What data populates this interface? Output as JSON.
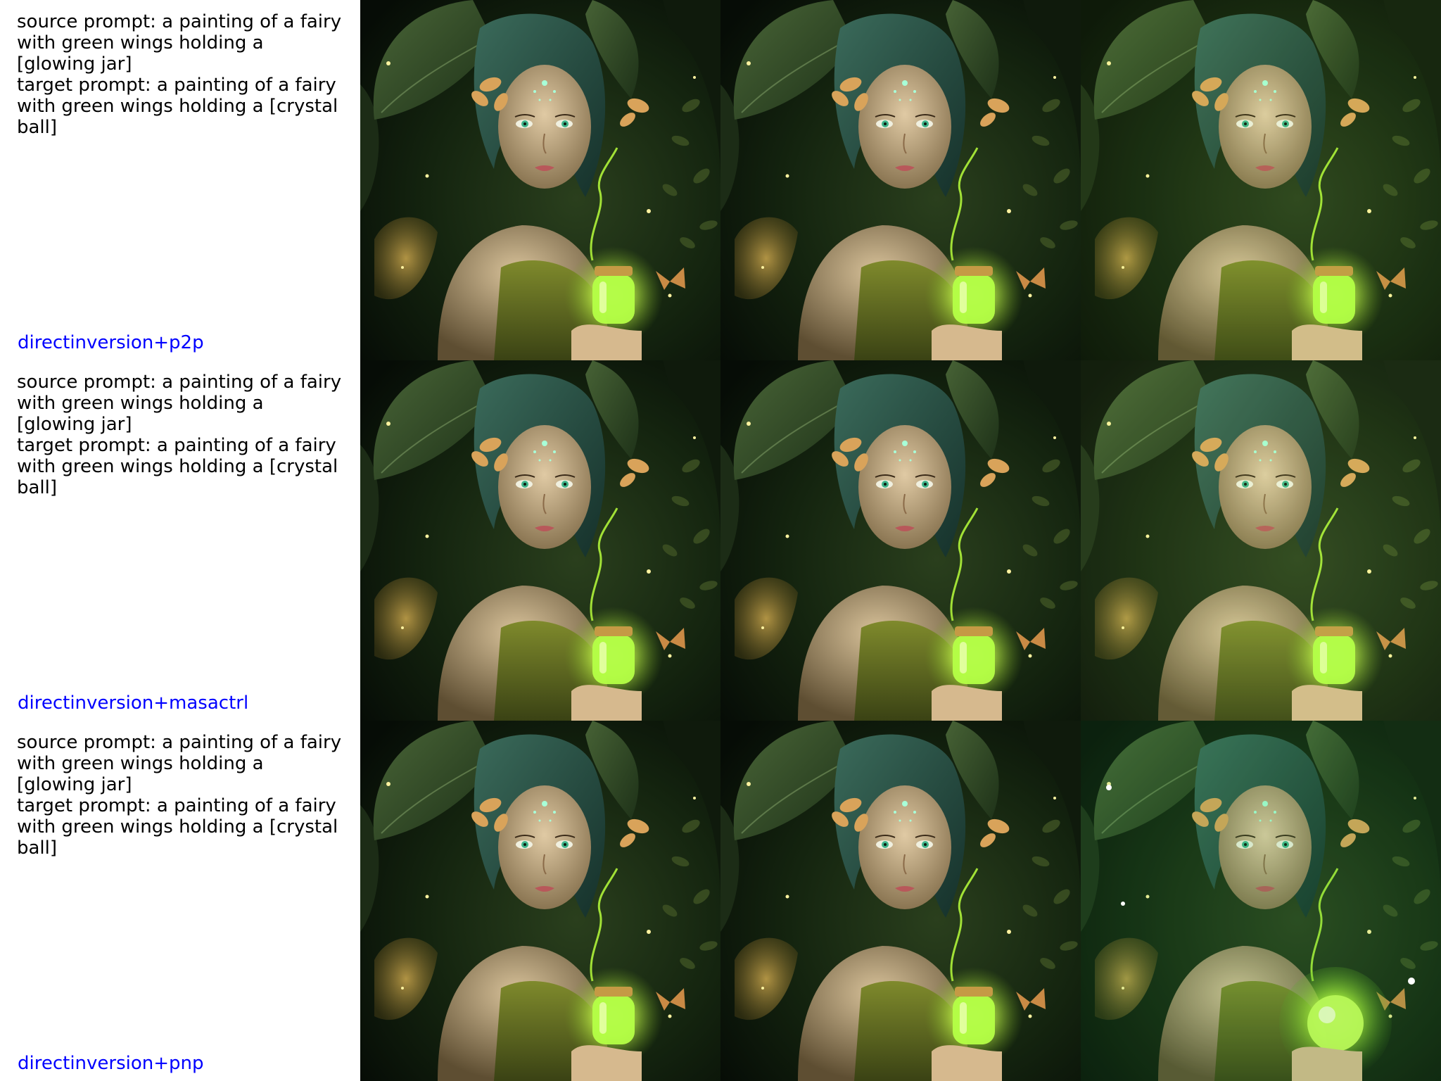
{
  "rows": [
    {
      "source_prompt": "source prompt: a painting of a fairy with green wings holding a [glowing jar]",
      "target_prompt": "target prompt: a painting of a fairy with green wings holding a [crystal ball]",
      "method": "directinversion+p2p",
      "images": [
        "fairy-source-image",
        "fairy-reconstruction-image",
        "fairy-edited-image"
      ]
    },
    {
      "source_prompt": "source prompt: a painting of a fairy with green wings holding a [glowing jar]",
      "target_prompt": "target prompt: a painting of a fairy with green wings holding a [crystal ball]",
      "method": "directinversion+masactrl",
      "images": [
        "fairy-source-image",
        "fairy-reconstruction-image",
        "fairy-edited-image"
      ]
    },
    {
      "source_prompt": "source prompt: a painting of a fairy with green wings holding a [glowing jar]",
      "target_prompt": "target prompt: a painting of a fairy with green wings holding a [crystal ball]",
      "method": "directinversion+pnp",
      "images": [
        "fairy-source-image",
        "fairy-reconstruction-image",
        "fairy-edited-image"
      ]
    }
  ],
  "colors": {
    "method_label": "#0000ff",
    "prompt_text": "#000000",
    "background": "#ffffff",
    "scene_dark": "#0d1a10",
    "foliage": "#2f4a25",
    "glow": "#c8ff4a",
    "skin": "#c9b08a",
    "hair": "#2e5a4c"
  }
}
